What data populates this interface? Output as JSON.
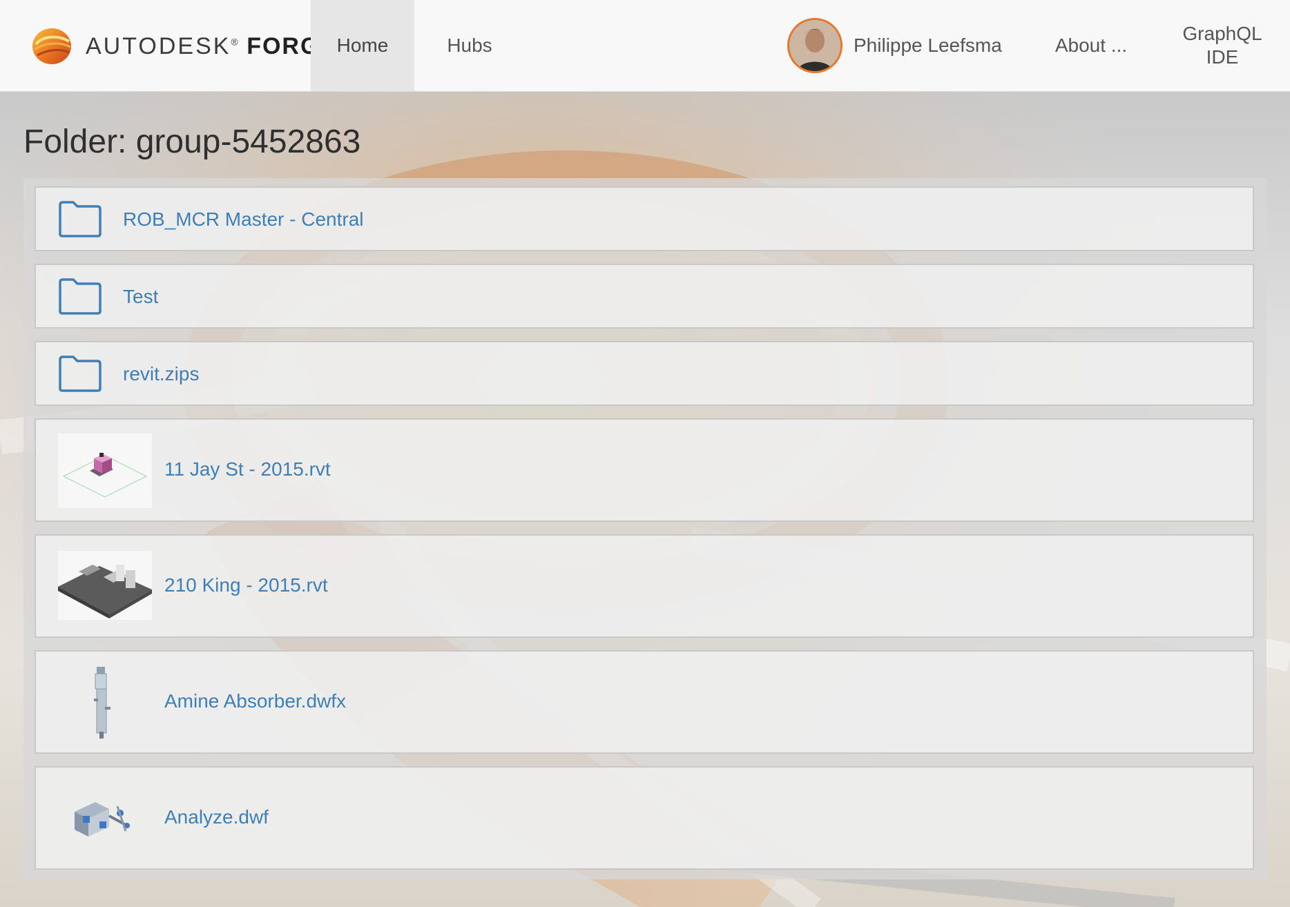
{
  "header": {
    "brand_name": "AUTODESK",
    "brand_reg": "®",
    "brand_product": "FORGE",
    "nav": {
      "home": "Home",
      "hubs": "Hubs",
      "user_name": "Philippe Leefsma",
      "about": "About ...",
      "graphql_line1": "GraphQL",
      "graphql_line2": "IDE"
    },
    "active_tab": "Home"
  },
  "page": {
    "title": "Folder: group-5452863"
  },
  "items": [
    {
      "type": "folder",
      "name": "ROB_MCR Master - Central",
      "icon": "folder-icon"
    },
    {
      "type": "folder",
      "name": "Test",
      "icon": "folder-icon"
    },
    {
      "type": "folder",
      "name": "revit.zips",
      "icon": "folder-icon"
    },
    {
      "type": "file",
      "name": "11 Jay St - 2015.rvt",
      "icon": "building-thumbnail"
    },
    {
      "type": "file",
      "name": "210 King - 2015.rvt",
      "icon": "building-thumbnail"
    },
    {
      "type": "file",
      "name": "Amine Absorber.dwfx",
      "icon": "absorber-thumbnail"
    },
    {
      "type": "file",
      "name": "Analyze.dwf",
      "icon": "clamp-thumbnail"
    }
  ],
  "colors": {
    "link": "#3e7fb7",
    "accent": "#e8782c",
    "navbar_bg": "#f8f8f8"
  }
}
